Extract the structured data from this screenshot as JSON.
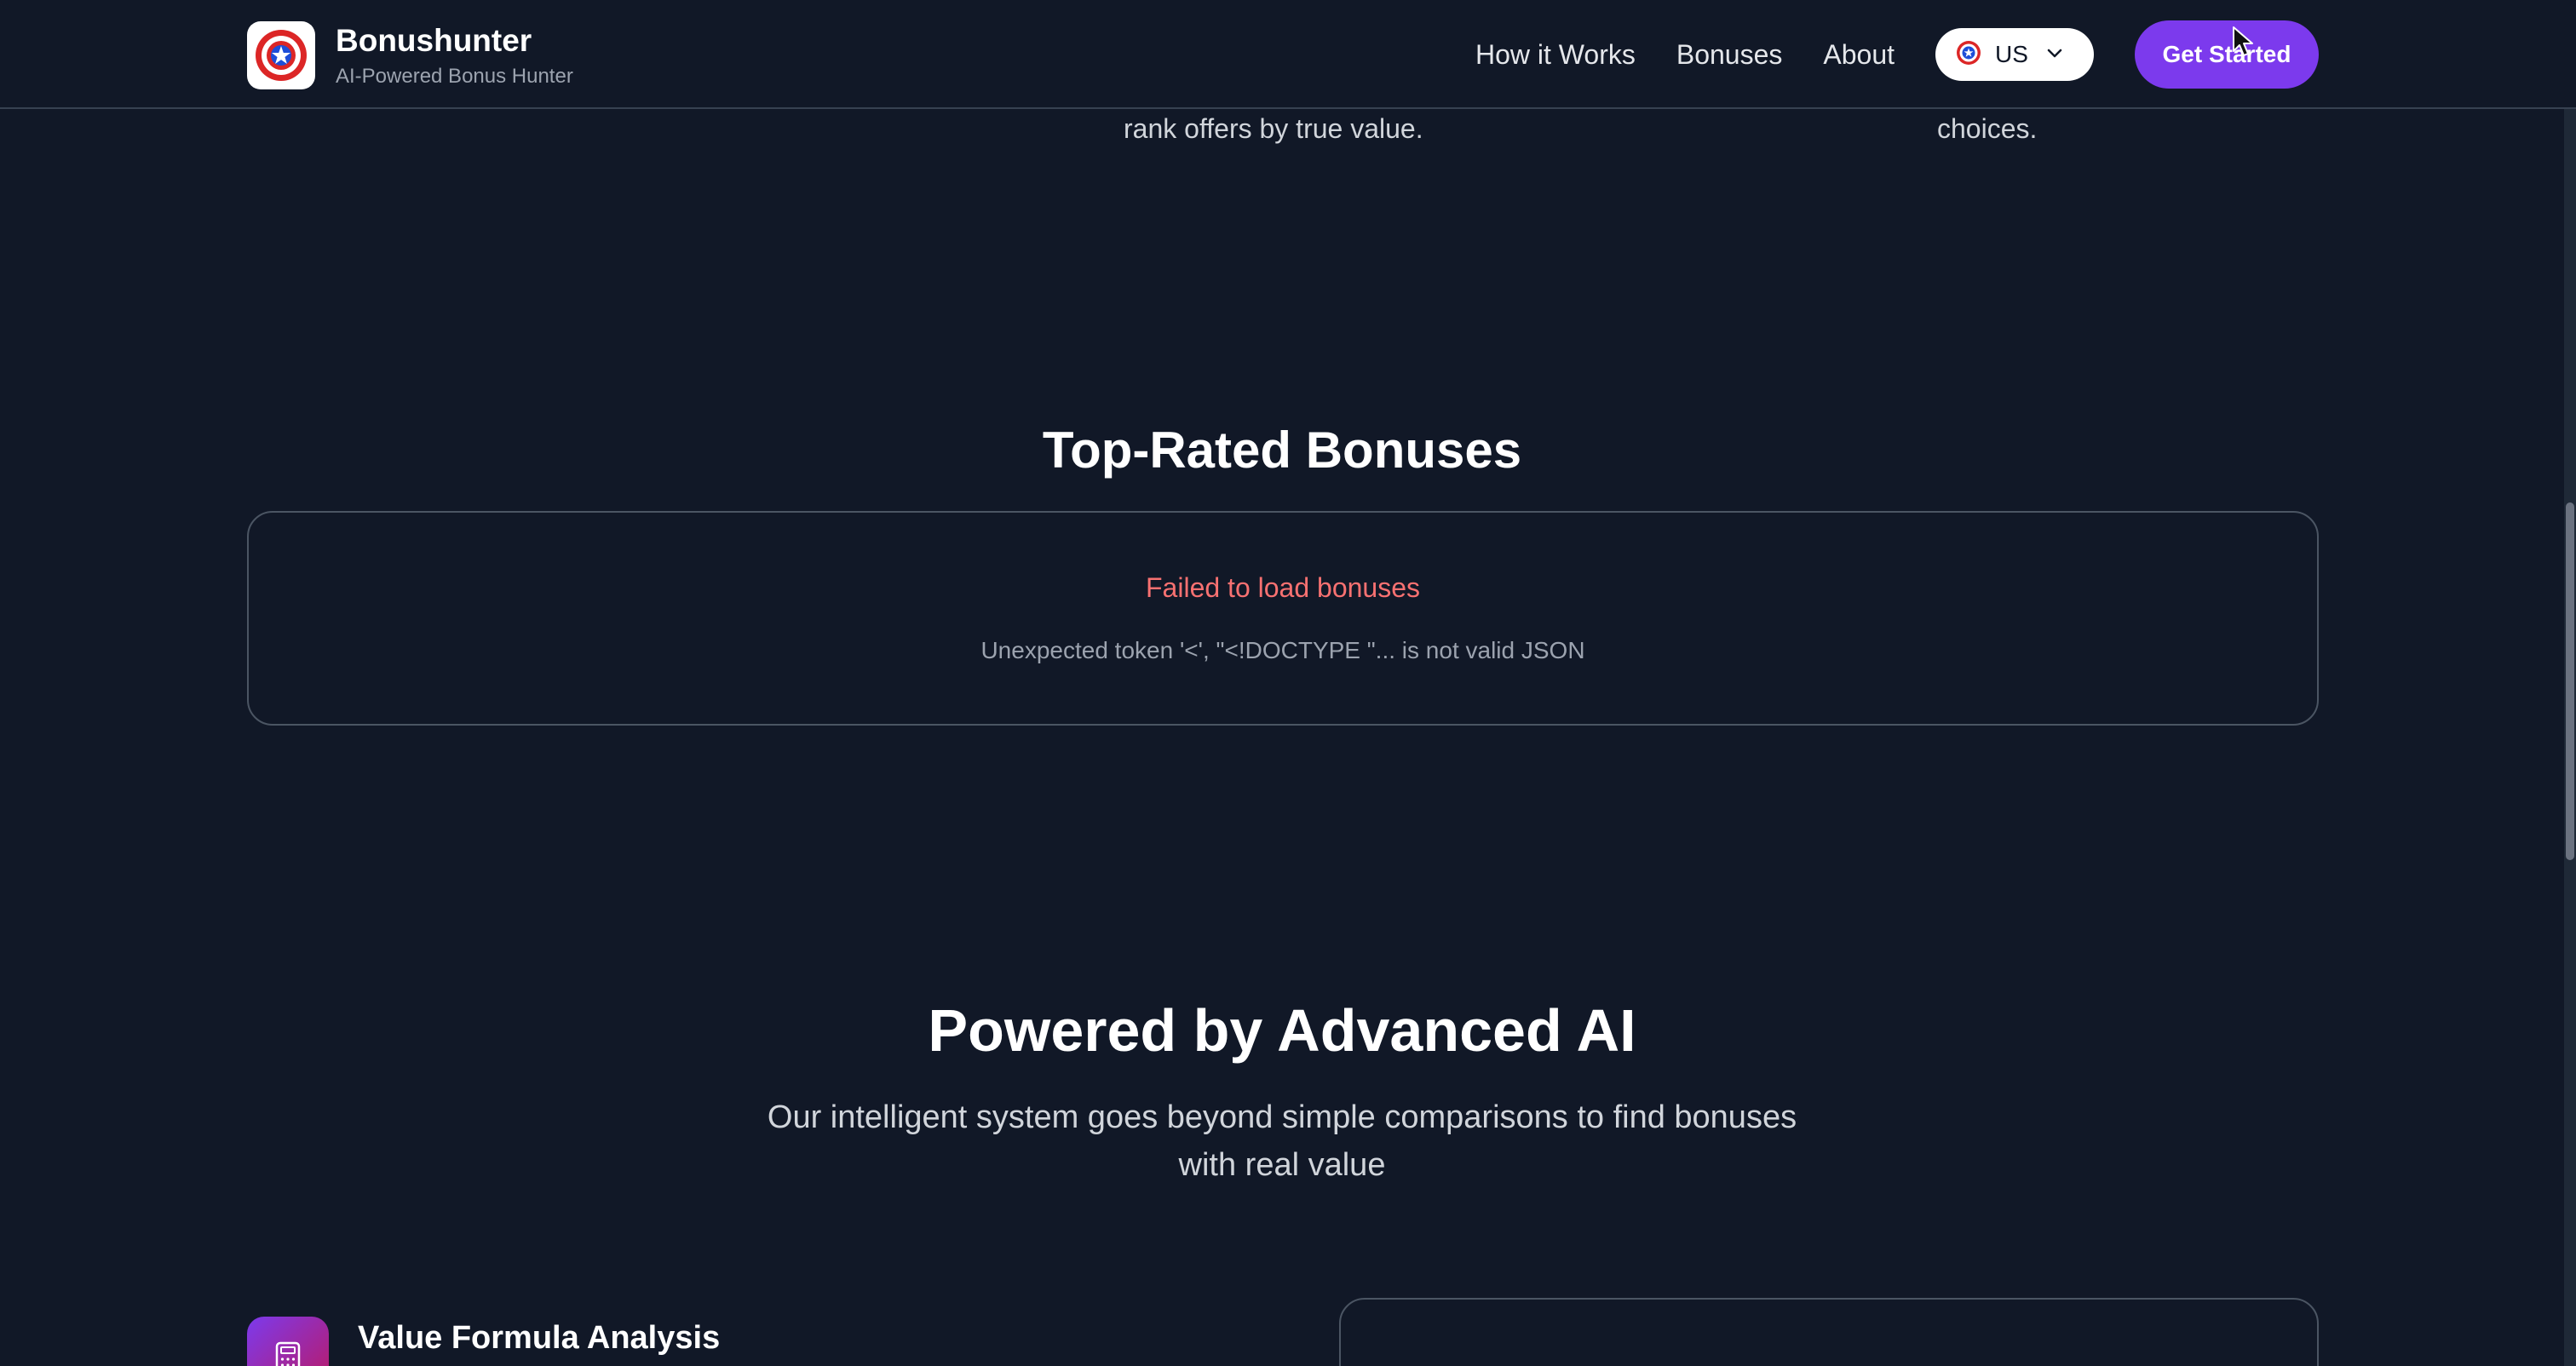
{
  "header": {
    "brand_name": "Bonushunter",
    "brand_tagline": "AI-Powered Bonus Hunter",
    "nav": [
      "How it Works",
      "Bonuses",
      "About"
    ],
    "country": {
      "selected": "US",
      "icon": "us-flag-icon"
    },
    "cta_label": "Get Started"
  },
  "partial_text": {
    "center": "rank offers by true value.",
    "right": "choices."
  },
  "top_rated": {
    "title": "Top-Rated Bonuses",
    "error_title": "Failed to load bonuses",
    "error_detail": "Unexpected token '<', \"<!DOCTYPE \"... is not valid JSON"
  },
  "powered": {
    "title": "Powered by Advanced AI",
    "subtitle_line1": "Our intelligent system goes beyond simple comparisons to find bonuses",
    "subtitle_line2": "with real value"
  },
  "feature": {
    "title": "Value Formula Analysis",
    "icon": "calculator-icon"
  },
  "colors": {
    "background": "#111827",
    "accent": "#7c3aed",
    "error": "#f87171"
  }
}
